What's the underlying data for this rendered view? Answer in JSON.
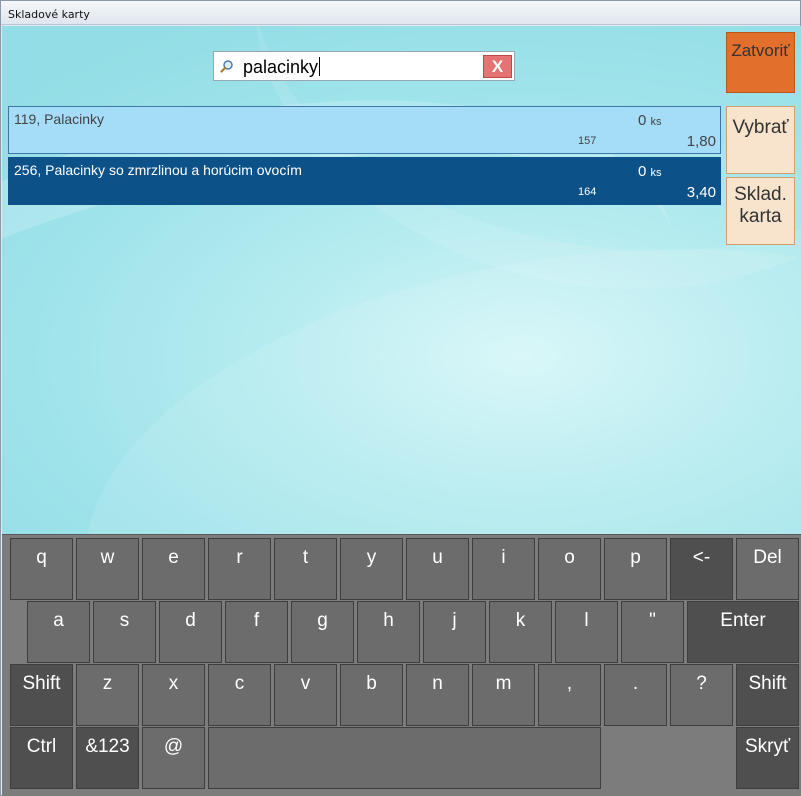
{
  "window": {
    "title": "Skladové karty"
  },
  "search": {
    "value": "palacinky",
    "search_icon": "magnifier-icon",
    "clear_label": "X"
  },
  "items": [
    {
      "name": "119, Palacinky",
      "quantity": "0",
      "unit": "ks",
      "code": "157",
      "price": "1,80",
      "selected": false
    },
    {
      "name": "256, Palacinky so zmrzlinou a horúcim ovocím",
      "quantity": "0",
      "unit": "ks",
      "code": "164",
      "price": "3,40",
      "selected": true
    }
  ],
  "side_buttons": {
    "close": "Zatvoriť",
    "select": "Vybrať",
    "card_line1": "Sklad.",
    "card_line2": "karta"
  },
  "keyboard": {
    "row1": [
      "q",
      "w",
      "e",
      "r",
      "t",
      "y",
      "u",
      "i",
      "o",
      "p",
      "<-",
      "Del"
    ],
    "row2": [
      "a",
      "s",
      "d",
      "f",
      "g",
      "h",
      "j",
      "k",
      "l",
      "\"",
      "Enter"
    ],
    "row3": [
      "Shift",
      "z",
      "x",
      "c",
      "v",
      "b",
      "n",
      "m",
      ",",
      ".",
      "?",
      "Shift"
    ],
    "row4": [
      "Ctrl",
      "&123",
      "@",
      "",
      "Skryť"
    ]
  },
  "colors": {
    "close_button": "#e36f2c",
    "selected_row": "#0c5289",
    "row": "#a5dcf8",
    "side_button": "#f8e4cc"
  }
}
